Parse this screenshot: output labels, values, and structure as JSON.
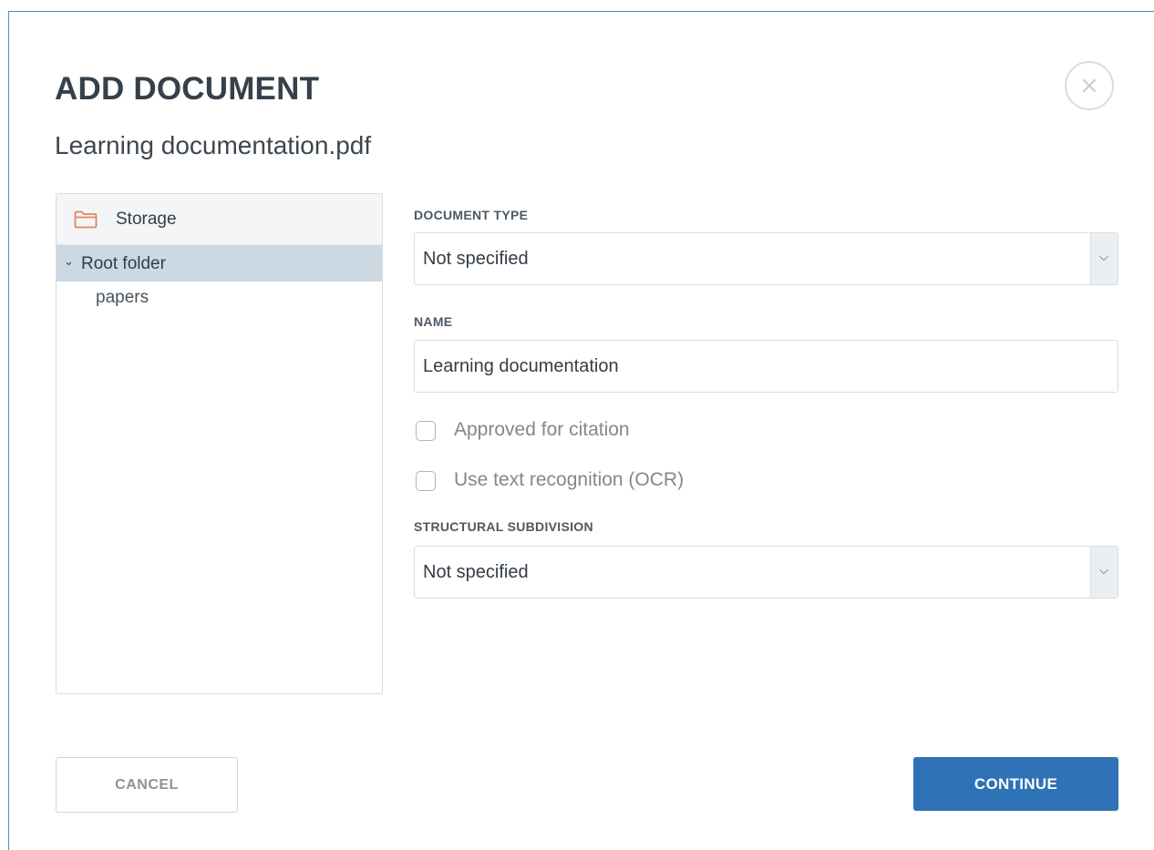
{
  "dialog": {
    "title": "ADD DOCUMENT",
    "filename": "Learning documentation.pdf",
    "close_icon": "close-icon"
  },
  "tree": {
    "header_label": "Storage",
    "header_icon": "folder-icon",
    "items": [
      {
        "label": "Root folder",
        "expanded": true,
        "selected": true
      },
      {
        "label": "papers",
        "expanded": false,
        "selected": false
      }
    ]
  },
  "form": {
    "document_type": {
      "label": "DOCUMENT TYPE",
      "value": "Not specified"
    },
    "name": {
      "label": "NAME",
      "value": "Learning documentation"
    },
    "approved_for_citation": {
      "label": "Approved for citation",
      "checked": false
    },
    "use_ocr": {
      "label": "Use text recognition (OCR)",
      "checked": false
    },
    "structural_subdivision": {
      "label": "STRUCTURAL SUBDIVISION",
      "value": "Not specified"
    }
  },
  "buttons": {
    "cancel": "CANCEL",
    "continue": "CONTINUE"
  },
  "colors": {
    "primary": "#2f72b5",
    "selected_row": "#ccd8e2",
    "folder_icon": "#e8845c",
    "dialog_border": "#4a8fc9"
  }
}
